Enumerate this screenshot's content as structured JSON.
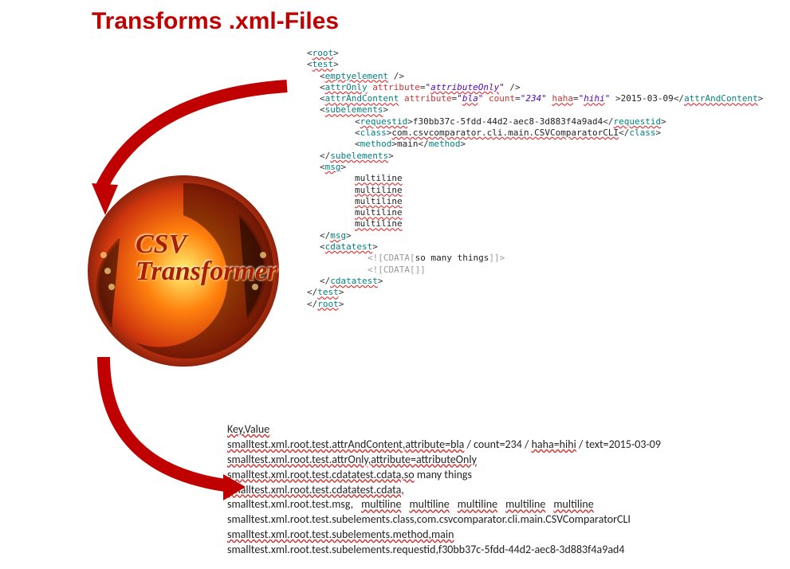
{
  "title": "Transforms .xml-Files",
  "logo_line1": "CSV",
  "logo_line2": "Transformer",
  "xml": {
    "root_open": "root",
    "test_open": "test",
    "emptyelement": "emptyelement",
    "attrOnly_tag": "attrOnly",
    "attrOnly_attrname": "attribute",
    "attrOnly_attrval": "attributeOnly",
    "aac_tag": "attrAndContent",
    "aac_attr1_name": "attribute",
    "aac_attr1_val": "bla",
    "aac_attr2_name": "count",
    "aac_attr2_val": "234",
    "aac_attr3_name": "haha",
    "aac_attr3_val": "hihi",
    "aac_text": "2015-03-09",
    "sub_open": "subelements",
    "requestid_tag": "requestid",
    "requestid_val": "f30bb37c-5fdd-44d2-aec8-3d883f4a9ad4",
    "class_tag": "class",
    "class_val": "com.csvcomparator.cli.main.CSVComparatorCLI",
    "method_tag": "method",
    "method_val": "main",
    "msg_tag": "msg",
    "multiline": "multiline",
    "cdatatest_tag": "cdatatest",
    "cdata_open": "<![CDATA[",
    "cdata_val": "so many things",
    "cdata_close": "]]>",
    "empty_cdata": "<![CDATA[]]"
  },
  "csv": {
    "header": "Key,Value",
    "r1a": "smalltest.xml.root.test.attrAndContent,attribute=bla",
    "r1b": " / count=234 / ",
    "r1c": "haha=hihi",
    "r1d": " / text=2015-03-09",
    "r2": "smalltest.xml.root.test.attrOnly,attribute=attributeOnly",
    "r3a": "smalltest.xml.root.test.cdatatest.cdata,so",
    "r3b": " many things",
    "r4": "smalltest.xml.root.test.cdatatest.cdata,",
    "r5a": "smalltest.xml.root.test.msg,",
    "r5b": "multiline",
    "r6": "smalltest.xml.root.test.subelements.class,com.csvcomparator.cli.main.CSVComparatorCLI",
    "r7": "smalltest.xml.root.test.subelements.method,main",
    "r8": "smalltest.xml.root.test.subelements.requestid,f30bb37c-5fdd-44d2-aec8-3d883f4a9ad4"
  }
}
